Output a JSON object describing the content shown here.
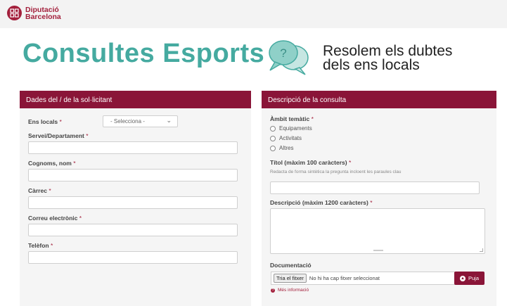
{
  "brand": {
    "line1": "Diputació",
    "line2": "Barcelona",
    "color": "#a3203c"
  },
  "hero": {
    "title": "Consultes Esports",
    "tagline_line1": "Resolem els dubtes",
    "tagline_line2": "dels ens locals",
    "bubble_icon": "chat-question-icon",
    "title_color": "#45aaa0"
  },
  "left_panel": {
    "header": "Dades del / de la sol·licitant",
    "ens_locals_label": "Ens locals",
    "ens_locals_value": "- Selecciona -",
    "servei_label": "Servei/Departament",
    "cognoms_label": "Cognoms, nom",
    "carrec_label": "Càrrec",
    "correu_label": "Correu electrònic",
    "telefon_label": "Telèfon",
    "required_mark": "*"
  },
  "right_panel": {
    "header": "Descripció de la consulta",
    "ambit_label": "Àmbit temàtic",
    "ambit_options": [
      "Equipaments",
      "Activitats",
      "Altres"
    ],
    "titol_label": "Títol (màxim 100 caràcters)",
    "titol_hint": "Redacta de forma sintètica la pregunta incloent les paraules clau",
    "descripcio_label": "Descripció (màxim 1200 caràcters)",
    "documentacio_label": "Documentació",
    "file_button": "Tria el fitxer",
    "file_status": "No hi ha cap fitxer seleccionat",
    "upload_button": "Puja",
    "more_info": "Més informació",
    "required_mark": "*"
  },
  "colors": {
    "header_bg": "#8a1538",
    "panel_bg": "#f5f5f5"
  }
}
